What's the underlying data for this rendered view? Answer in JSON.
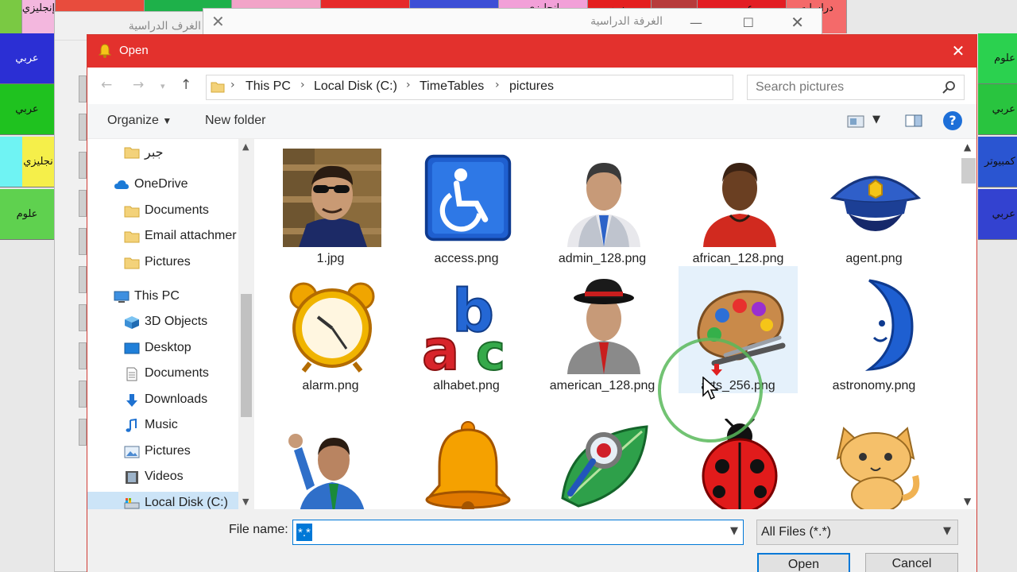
{
  "background": {
    "top_cells": [
      {
        "label": "",
        "color": "#7ac943"
      },
      {
        "label": "إنجليزي",
        "color": "#f3b7de"
      },
      {
        "label": "",
        "color": "#e84c3d"
      },
      {
        "label": "",
        "color": "#1eb14a"
      },
      {
        "label": "",
        "color": "#f2a4c8"
      },
      {
        "label": "",
        "color": "#e62a2a"
      },
      {
        "label": "",
        "color": "#3d4fd6"
      },
      {
        "label": "إنجليزي",
        "color": "#f2a0d8"
      },
      {
        "label": "رسم",
        "color": "#e41f1f"
      },
      {
        "label": "",
        "color": "#b73b3b"
      },
      {
        "label": "عربي",
        "color": "#e31e24"
      },
      {
        "label": "دراسات",
        "color": "#f46a6a"
      }
    ],
    "left_cells": [
      {
        "label": "عربي",
        "color": "#2b2fd4"
      },
      {
        "label": "عربي",
        "color": "#1fc21f"
      },
      {
        "label": "نجليزي",
        "color": "#f5ef4a"
      },
      {
        "label": "علوم",
        "color": "#5fd14f"
      }
    ],
    "right_cells": [
      {
        "label": "علوم",
        "color": "#2bd14f"
      },
      {
        "label": "عربي",
        "color": "#29c43f"
      },
      {
        "label": "كمبيوتر",
        "color": "#2a55d1"
      },
      {
        "label": "عربي",
        "color": "#3342d0"
      }
    ],
    "window1_title": "الغرف الدراسية",
    "window2_title": "الغرفة الدراسية"
  },
  "dialog": {
    "title": "Open",
    "nav": {
      "back": "←",
      "forward": "→",
      "up": "↑",
      "breadcrumbs": [
        "This PC",
        "Local Disk (C:)",
        "TimeTables",
        "pictures"
      ],
      "search_placeholder": "Search pictures"
    },
    "commands": {
      "organize": "Organize",
      "new_folder": "New folder"
    },
    "tree": [
      {
        "label": "جبر",
        "icon": "folder-icon",
        "indent": 1
      },
      {
        "label": "OneDrive",
        "icon": "cloud-icon",
        "indent": 0
      },
      {
        "label": "Documents",
        "icon": "folder-icon",
        "indent": 1
      },
      {
        "label": "Email attachmer",
        "icon": "folder-icon",
        "indent": 1
      },
      {
        "label": "Pictures",
        "icon": "folder-icon",
        "indent": 1
      },
      {
        "label": "This PC",
        "icon": "computer-icon",
        "indent": 0
      },
      {
        "label": "3D Objects",
        "icon": "cube-icon",
        "indent": 1
      },
      {
        "label": "Desktop",
        "icon": "desktop-icon",
        "indent": 1
      },
      {
        "label": "Documents",
        "icon": "document-icon",
        "indent": 1
      },
      {
        "label": "Downloads",
        "icon": "download-icon",
        "indent": 1
      },
      {
        "label": "Music",
        "icon": "music-icon",
        "indent": 1
      },
      {
        "label": "Pictures",
        "icon": "pictures-icon",
        "indent": 1
      },
      {
        "label": "Videos",
        "icon": "video-icon",
        "indent": 1
      },
      {
        "label": "Local Disk (C:)",
        "icon": "drive-icon",
        "indent": 1
      }
    ],
    "files": [
      {
        "name": "1.jpg",
        "icon": "photo-man-icon"
      },
      {
        "name": "access.png",
        "icon": "wheelchair-icon"
      },
      {
        "name": "admin_128.png",
        "icon": "admin-person-icon"
      },
      {
        "name": "african_128.png",
        "icon": "african-person-icon"
      },
      {
        "name": "agent.png",
        "icon": "police-cap-icon"
      },
      {
        "name": "alarm.png",
        "icon": "alarm-clock-icon"
      },
      {
        "name": "alhabet.png",
        "icon": "abc-icon"
      },
      {
        "name": "american_128.png",
        "icon": "american-person-icon"
      },
      {
        "name": "arts_256.png",
        "icon": "palette-icon"
      },
      {
        "name": "astronomy.png",
        "icon": "moon-icon"
      },
      {
        "name": "",
        "icon": "waving-man-icon"
      },
      {
        "name": "",
        "icon": "bell-icon"
      },
      {
        "name": "",
        "icon": "leaf-magnifier-icon"
      },
      {
        "name": "",
        "icon": "ladybug-icon"
      },
      {
        "name": "",
        "icon": "cat-icon"
      }
    ],
    "footer": {
      "file_name_label": "File name:",
      "file_name_value": "*.*",
      "filter_value": "All Files (*.*)",
      "open_label": "Open",
      "cancel_label": "Cancel"
    },
    "accent_color": "#e3312d",
    "selection_color": "#0078d7"
  }
}
